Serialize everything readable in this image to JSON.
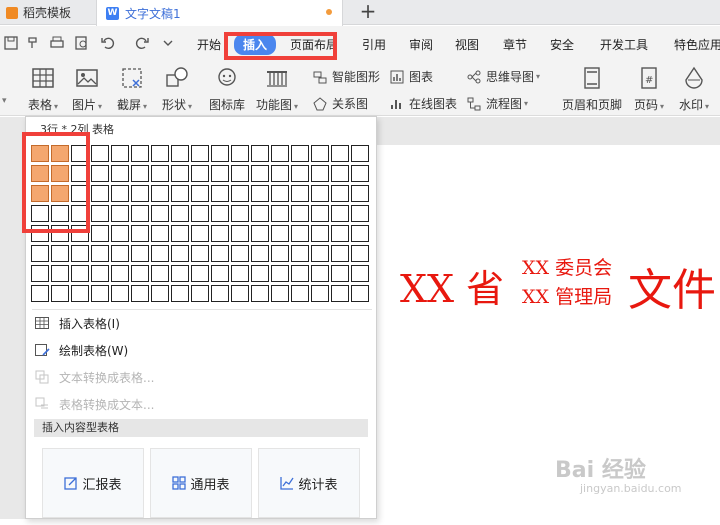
{
  "tabs": {
    "template_label": "稻壳模板",
    "doc_label": "文字文稿1",
    "doc_icon": "W",
    "new_tab_icon": "+"
  },
  "quick_access": [
    "save-icon",
    "format-painter-icon",
    "print-icon",
    "print-preview-icon",
    "undo-icon",
    "redo-icon",
    "more-icon"
  ],
  "menu": {
    "items": [
      "开始",
      "插入",
      "页面布局",
      "引用",
      "审阅",
      "视图",
      "章节",
      "安全",
      "开发工具",
      "特色应用"
    ],
    "active": "插入"
  },
  "ribbon": {
    "table": "表格",
    "picture": "图片",
    "screenshot": "截屏",
    "shape": "形状",
    "icon_lib": "图标库",
    "function_chart": "功能图",
    "smart_art": "智能图形",
    "relation_chart": "关系图",
    "chart": "图表",
    "online_chart": "在线图表",
    "mindmap": "思维导图",
    "flowchart": "流程图",
    "header_footer": "页眉和页脚",
    "page_number": "页码",
    "watermark": "水印"
  },
  "dropdown": {
    "grid_caption": "3行 * 2列 表格",
    "grid_rows": 8,
    "grid_cols": 17,
    "selected_rows": 3,
    "selected_cols": 2,
    "items": [
      {
        "label": "插入表格(I)",
        "icon": "insert-table-icon",
        "enabled": true
      },
      {
        "label": "绘制表格(W)",
        "icon": "draw-table-icon",
        "enabled": true
      },
      {
        "label": "文本转换成表格...",
        "icon": "text-to-table-icon",
        "enabled": false
      },
      {
        "label": "表格转换成文本...",
        "icon": "table-to-text-icon",
        "enabled": false
      }
    ],
    "section_title": "插入内容型表格",
    "cards": [
      "汇报表",
      "通用表",
      "统计表"
    ]
  },
  "document": {
    "header_province": "XX 省",
    "header_line1": "XX 委员会",
    "header_line2": "XX 管理局",
    "header_suffix": "文件",
    "text_color": "#e8180f"
  },
  "watermark": {
    "brand": "Bai 经验",
    "url": "jingyan.baidu.com"
  },
  "colors": {
    "accent": "#4b86ee",
    "highlight_box": "#f0403a",
    "selected_cell": "#f4a76f"
  }
}
